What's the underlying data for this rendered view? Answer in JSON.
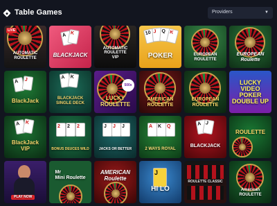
{
  "header": {
    "title": "Table Games",
    "providers_label": "Providers"
  },
  "tiles": [
    {
      "name": "AUTOMATIC\nROULETTE",
      "badge": "LIVE"
    },
    {
      "name": "BLACKJACK"
    },
    {
      "name": "AUTOMATIC\nROULETTE\nVIP"
    },
    {
      "name": "POKER"
    },
    {
      "name": "EUROPEAN\nROULETTE"
    },
    {
      "name": "EUROPEAN\nRoulette"
    },
    {
      "name": "BlackJack"
    },
    {
      "name": "BLACKJACK\nSINGLE DECK"
    },
    {
      "name": "LUCKY\nROULETTE",
      "multiplier": "500x"
    },
    {
      "name": "AMERICAN\nROULETTE"
    },
    {
      "name": "EUROPEAN\nROULETTE"
    },
    {
      "name": "LUCKY\nVIDEO\nPOKER\nDOUBLE UP"
    },
    {
      "name": "BlackJack\nVIP"
    },
    {
      "name": "BONUS DEUCES WILD"
    },
    {
      "name": "JACKS OR BETTER"
    },
    {
      "name": "2 WAYS ROYAL"
    },
    {
      "name": "BLACKJACK"
    },
    {
      "name": "ROULETTE"
    },
    {
      "name": "PLAY NOW"
    },
    {
      "name": "Mr\nMini Roulette"
    },
    {
      "name": "AMERICAN\nRoulette"
    },
    {
      "name": "HI LO"
    },
    {
      "name": "ROULETTE CLASSIC"
    },
    {
      "name": "American\nROULETTE"
    }
  ],
  "colors": {
    "background": "#12151f",
    "dropdown": "#1f2433",
    "accent_red": "#e0242a"
  }
}
